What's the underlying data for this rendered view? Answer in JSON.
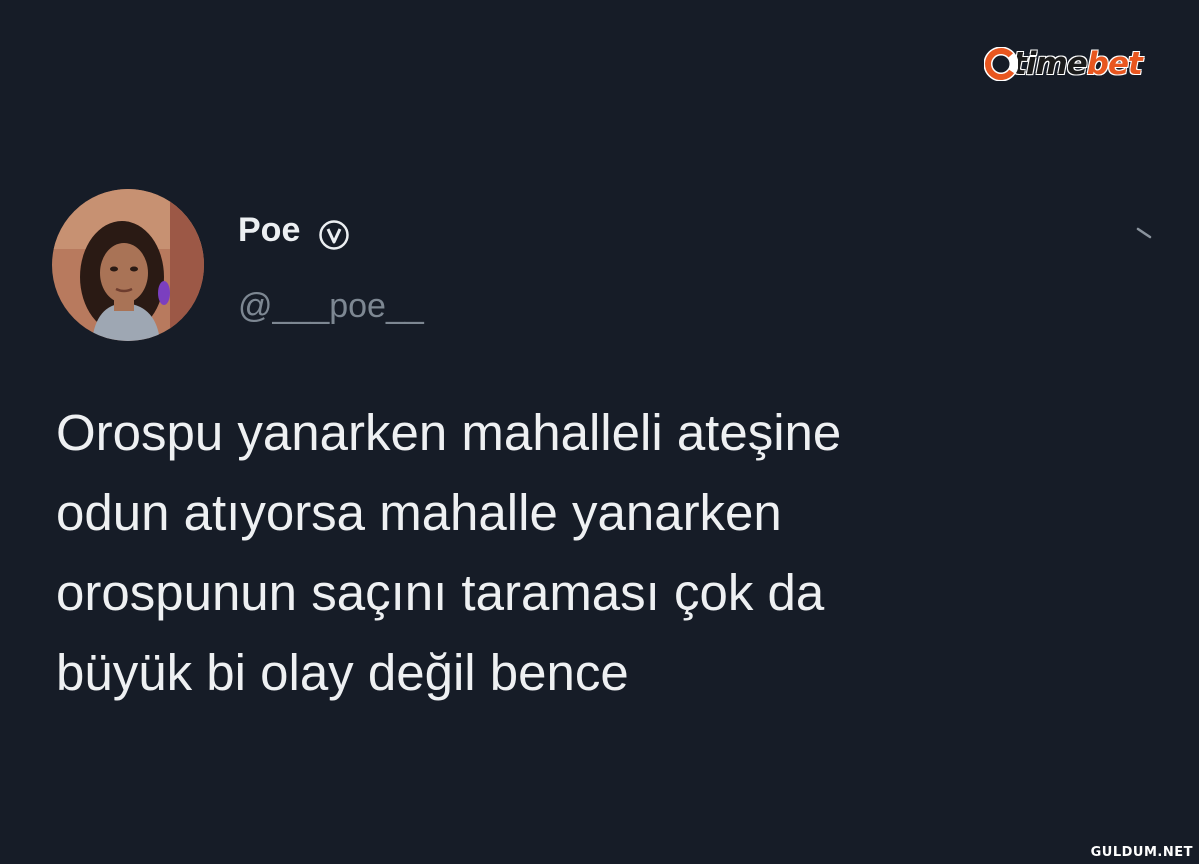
{
  "watermark": {
    "brand_part1": "time",
    "brand_part2": "bet",
    "brand_color": "#e8561f"
  },
  "tweet": {
    "author": {
      "display_name": "Poe",
      "handle": "@___poe__",
      "verified_icon": "verified-badge-icon",
      "avatar": "profile-photo"
    },
    "menu_icon": "chevron-down-icon",
    "text": "Orospu yanarken mahalleli ateşine\nodun atıyorsa mahalle yanarken\norospunun saçını taraması çok da\nbüyük bi olay değil bence"
  },
  "footer": {
    "site": "GULDUM.NET"
  },
  "colors": {
    "background": "#161c27",
    "text_primary": "#eef0f2",
    "text_secondary": "#7d8792"
  }
}
